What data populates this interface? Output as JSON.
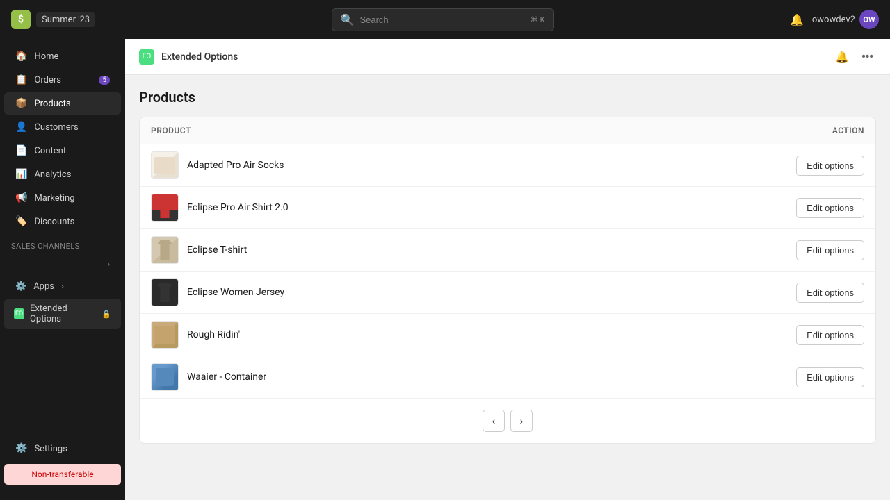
{
  "topbar": {
    "logo_text": "$",
    "store_name": "Summer '23",
    "search_placeholder": "Search",
    "search_shortcut": "⌘ K",
    "username": "owowdev2",
    "avatar_text": "OW"
  },
  "sidebar": {
    "nav_items": [
      {
        "id": "home",
        "label": "Home",
        "icon": "🏠",
        "badge": null
      },
      {
        "id": "orders",
        "label": "Orders",
        "icon": "📋",
        "badge": "5"
      },
      {
        "id": "products",
        "label": "Products",
        "icon": "📦",
        "badge": null
      },
      {
        "id": "customers",
        "label": "Customers",
        "icon": "👤",
        "badge": null
      },
      {
        "id": "content",
        "label": "Content",
        "icon": "📄",
        "badge": null
      },
      {
        "id": "analytics",
        "label": "Analytics",
        "icon": "📊",
        "badge": null
      },
      {
        "id": "marketing",
        "label": "Marketing",
        "icon": "📢",
        "badge": null
      },
      {
        "id": "discounts",
        "label": "Discounts",
        "icon": "🏷️",
        "badge": null
      }
    ],
    "sales_channels_label": "Sales channels",
    "apps_label": "Apps",
    "extended_options_label": "Extended Options",
    "settings_label": "Settings",
    "non_transferable_label": "Non-transferable"
  },
  "app_header": {
    "title": "Extended Options",
    "icon_label": "EO"
  },
  "page": {
    "title": "Products",
    "table": {
      "col_product": "Product",
      "col_action": "Action",
      "rows": [
        {
          "id": 1,
          "name": "Adapted Pro Air Socks",
          "thumb_class": "thumb-socks",
          "action_label": "Edit options"
        },
        {
          "id": 2,
          "name": "Eclipse Pro Air Shirt 2.0",
          "thumb_class": "thumb-shirt",
          "action_label": "Edit options"
        },
        {
          "id": 3,
          "name": "Eclipse T-shirt",
          "thumb_class": "thumb-tshirt",
          "action_label": "Edit options"
        },
        {
          "id": 4,
          "name": "Eclipse Women Jersey",
          "thumb_class": "thumb-jersey",
          "action_label": "Edit options"
        },
        {
          "id": 5,
          "name": "Rough Ridin'",
          "thumb_class": "thumb-ridin",
          "action_label": "Edit options"
        },
        {
          "id": 6,
          "name": "Waaier - Container",
          "thumb_class": "thumb-container",
          "action_label": "Edit options"
        }
      ]
    }
  }
}
